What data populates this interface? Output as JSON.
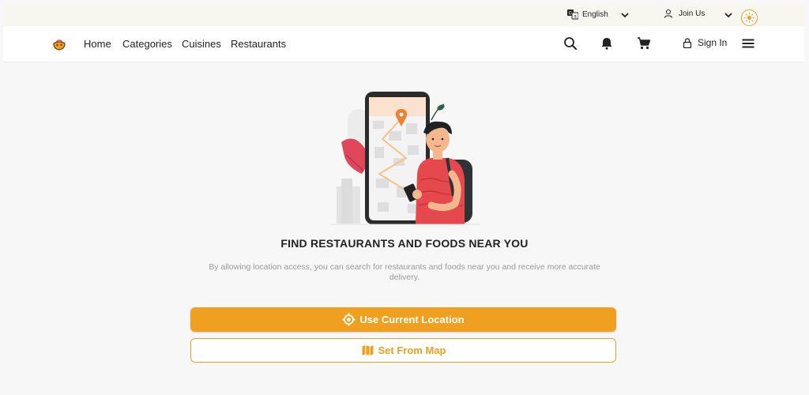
{
  "topbar": {
    "language": "English",
    "join": "Join Us"
  },
  "nav": {
    "items": [
      "Home",
      "Categories",
      "Cuisines",
      "Restaurants"
    ],
    "sign_in": "Sign In"
  },
  "main": {
    "heading": "FIND RESTAURANTS AND FOODS NEAR YOU",
    "description": "By allowing location access, you can search for restaurants and foods near you and receive more accurate delivery.",
    "primary_button": "Use Current Location",
    "secondary_button": "Set From Map"
  },
  "colors": {
    "accent": "#f0a020",
    "topbar_bg": "#f8f6f1",
    "page_bg": "#f7f7f7"
  },
  "icons": [
    "translate-icon",
    "chevron-down-icon",
    "user-icon",
    "sun-icon",
    "logo-icon",
    "search-icon",
    "bell-icon",
    "cart-icon",
    "lock-icon",
    "hamburger-menu-icon",
    "location-target-icon",
    "map-icon"
  ]
}
